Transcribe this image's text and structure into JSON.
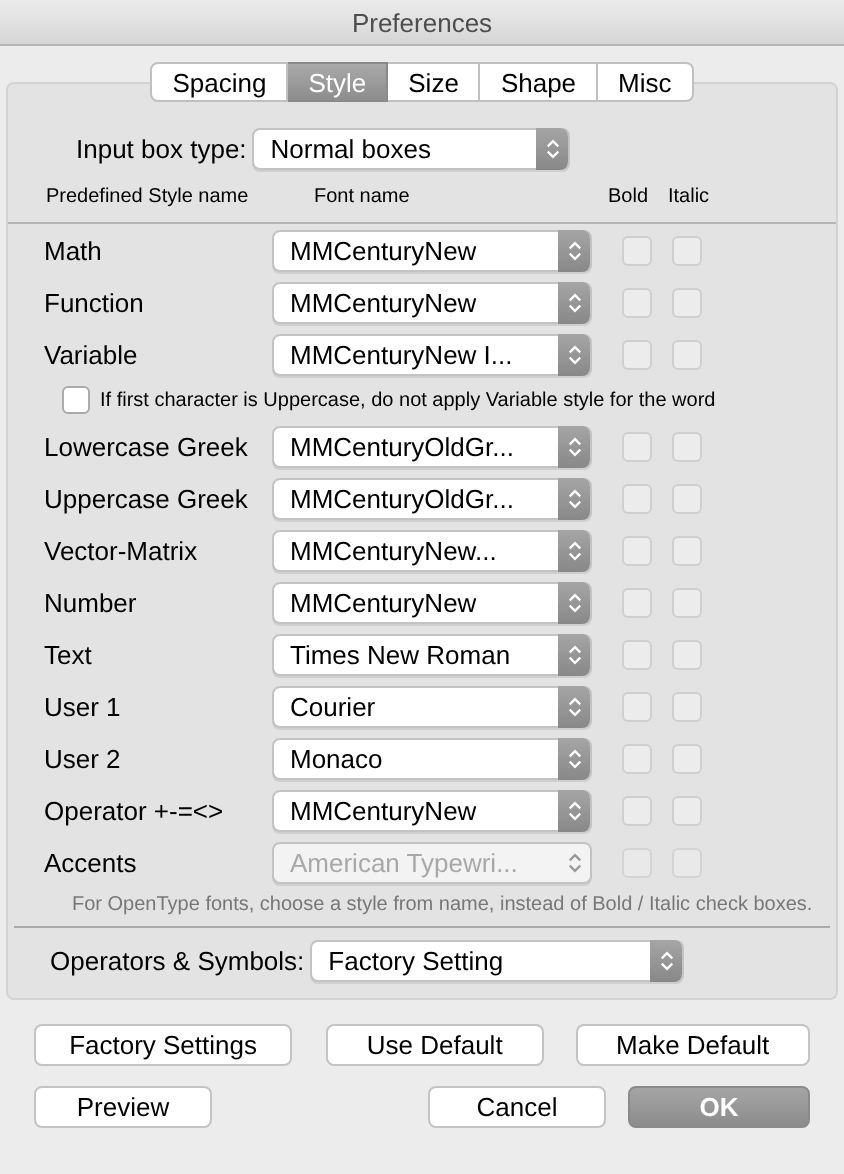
{
  "window": {
    "title": "Preferences"
  },
  "tabs": [
    {
      "label": "Spacing",
      "selected": false
    },
    {
      "label": "Style",
      "selected": true
    },
    {
      "label": "Size",
      "selected": false
    },
    {
      "label": "Shape",
      "selected": false
    },
    {
      "label": "Misc",
      "selected": false
    }
  ],
  "input_box_type": {
    "label": "Input box type:",
    "value": "Normal boxes"
  },
  "columns": [
    "Predefined Style name",
    "Font name",
    "Bold",
    "Italic"
  ],
  "styles": [
    {
      "kind": "style",
      "name": "Math",
      "font": "MMCenturyNew",
      "bold": false,
      "italic": false,
      "disabled": false
    },
    {
      "kind": "style",
      "name": "Function",
      "font": "MMCenturyNew",
      "bold": false,
      "italic": false,
      "disabled": false
    },
    {
      "kind": "style",
      "name": "Variable",
      "font": "MMCenturyNew I...",
      "bold": false,
      "italic": false,
      "disabled": false
    },
    {
      "kind": "option",
      "label": "If first character is Uppercase, do not apply Variable style for the word",
      "checked": false
    },
    {
      "kind": "style",
      "name": "Lowercase Greek",
      "font": "MMCenturyOldGr...",
      "bold": false,
      "italic": false,
      "disabled": false
    },
    {
      "kind": "style",
      "name": "Uppercase Greek",
      "font": "MMCenturyOldGr...",
      "bold": false,
      "italic": false,
      "disabled": false
    },
    {
      "kind": "style",
      "name": "Vector-Matrix",
      "font": "MMCenturyNew...",
      "bold": false,
      "italic": false,
      "disabled": false
    },
    {
      "kind": "style",
      "name": "Number",
      "font": "MMCenturyNew",
      "bold": false,
      "italic": false,
      "disabled": false
    },
    {
      "kind": "style",
      "name": "Text",
      "font": "Times New Roman",
      "bold": false,
      "italic": false,
      "disabled": false
    },
    {
      "kind": "style",
      "name": "User 1",
      "font": "Courier",
      "bold": false,
      "italic": false,
      "disabled": false
    },
    {
      "kind": "style",
      "name": "User 2",
      "font": "Monaco",
      "bold": false,
      "italic": false,
      "disabled": false
    },
    {
      "kind": "style",
      "name": "Operator +-=<>",
      "font": "MMCenturyNew",
      "bold": false,
      "italic": false,
      "disabled": false
    },
    {
      "kind": "style",
      "name": "Accents",
      "font": "American Typewri...",
      "bold": false,
      "italic": false,
      "disabled": true
    }
  ],
  "note": "For OpenType fonts, choose a style from name, instead of Bold / Italic check boxes.",
  "operators": {
    "label": "Operators & Symbols:",
    "value": "Factory Setting"
  },
  "buttons": [
    {
      "label": "Factory Settings",
      "default": false
    },
    {
      "label": "Use Default",
      "default": false
    },
    {
      "label": "Make Default",
      "default": false
    },
    {
      "label": "Preview",
      "default": false
    },
    {
      "label": "Cancel",
      "default": false
    },
    {
      "label": "OK",
      "default": true
    }
  ]
}
